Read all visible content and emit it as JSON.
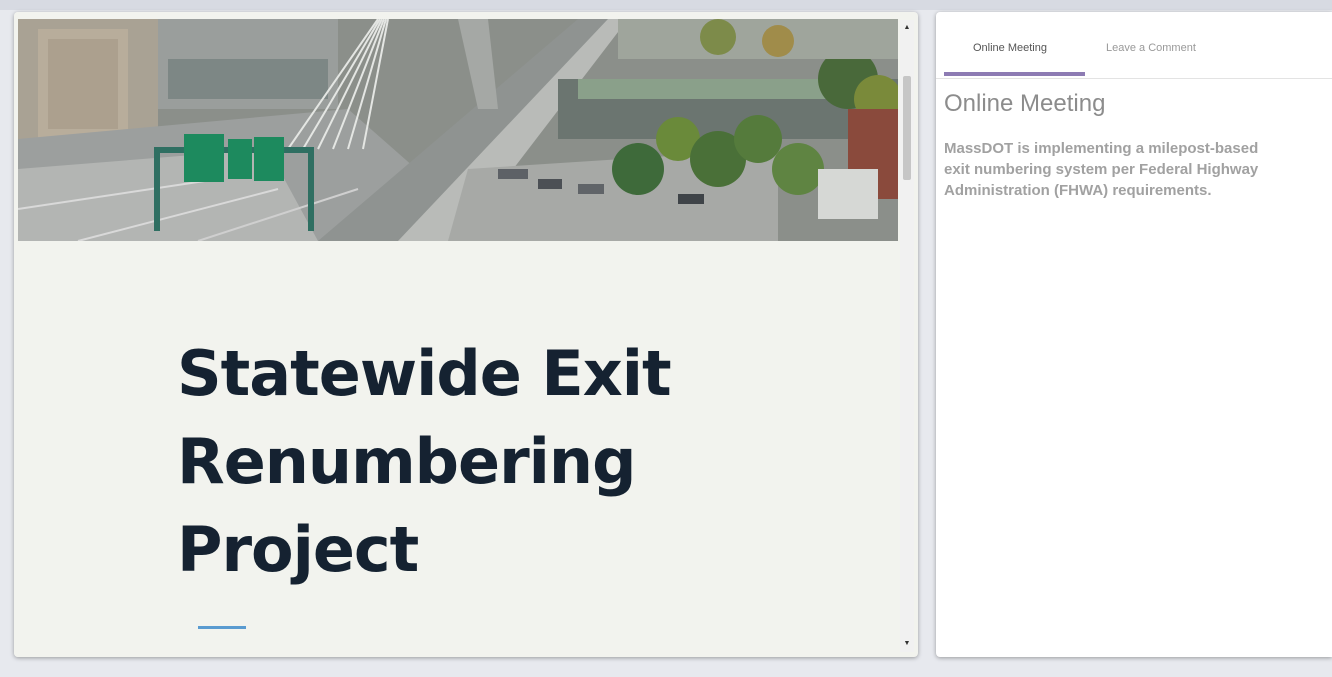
{
  "slide": {
    "image_alt": "Boston Zakim bridge and interstate highway aerial photo",
    "title_lines": [
      "Statewide Exit",
      "Renumbering",
      "Project"
    ]
  },
  "scrollbar": {
    "up_arrow": "▲",
    "down_arrow": "▼"
  },
  "sidebar": {
    "tabs": [
      {
        "label": "Online Meeting",
        "active": true
      },
      {
        "label": "Leave a Comment",
        "active": false
      }
    ],
    "heading": "Online Meeting",
    "text_lines": [
      "MassDOT is implementing a milepost-based",
      "exit numbering system per Federal Highway",
      "Administration (FHWA) requirements."
    ],
    "accent_color": "#8d7bb3"
  },
  "colors": {
    "title": "#152231",
    "rule": "#5a9bd0"
  }
}
